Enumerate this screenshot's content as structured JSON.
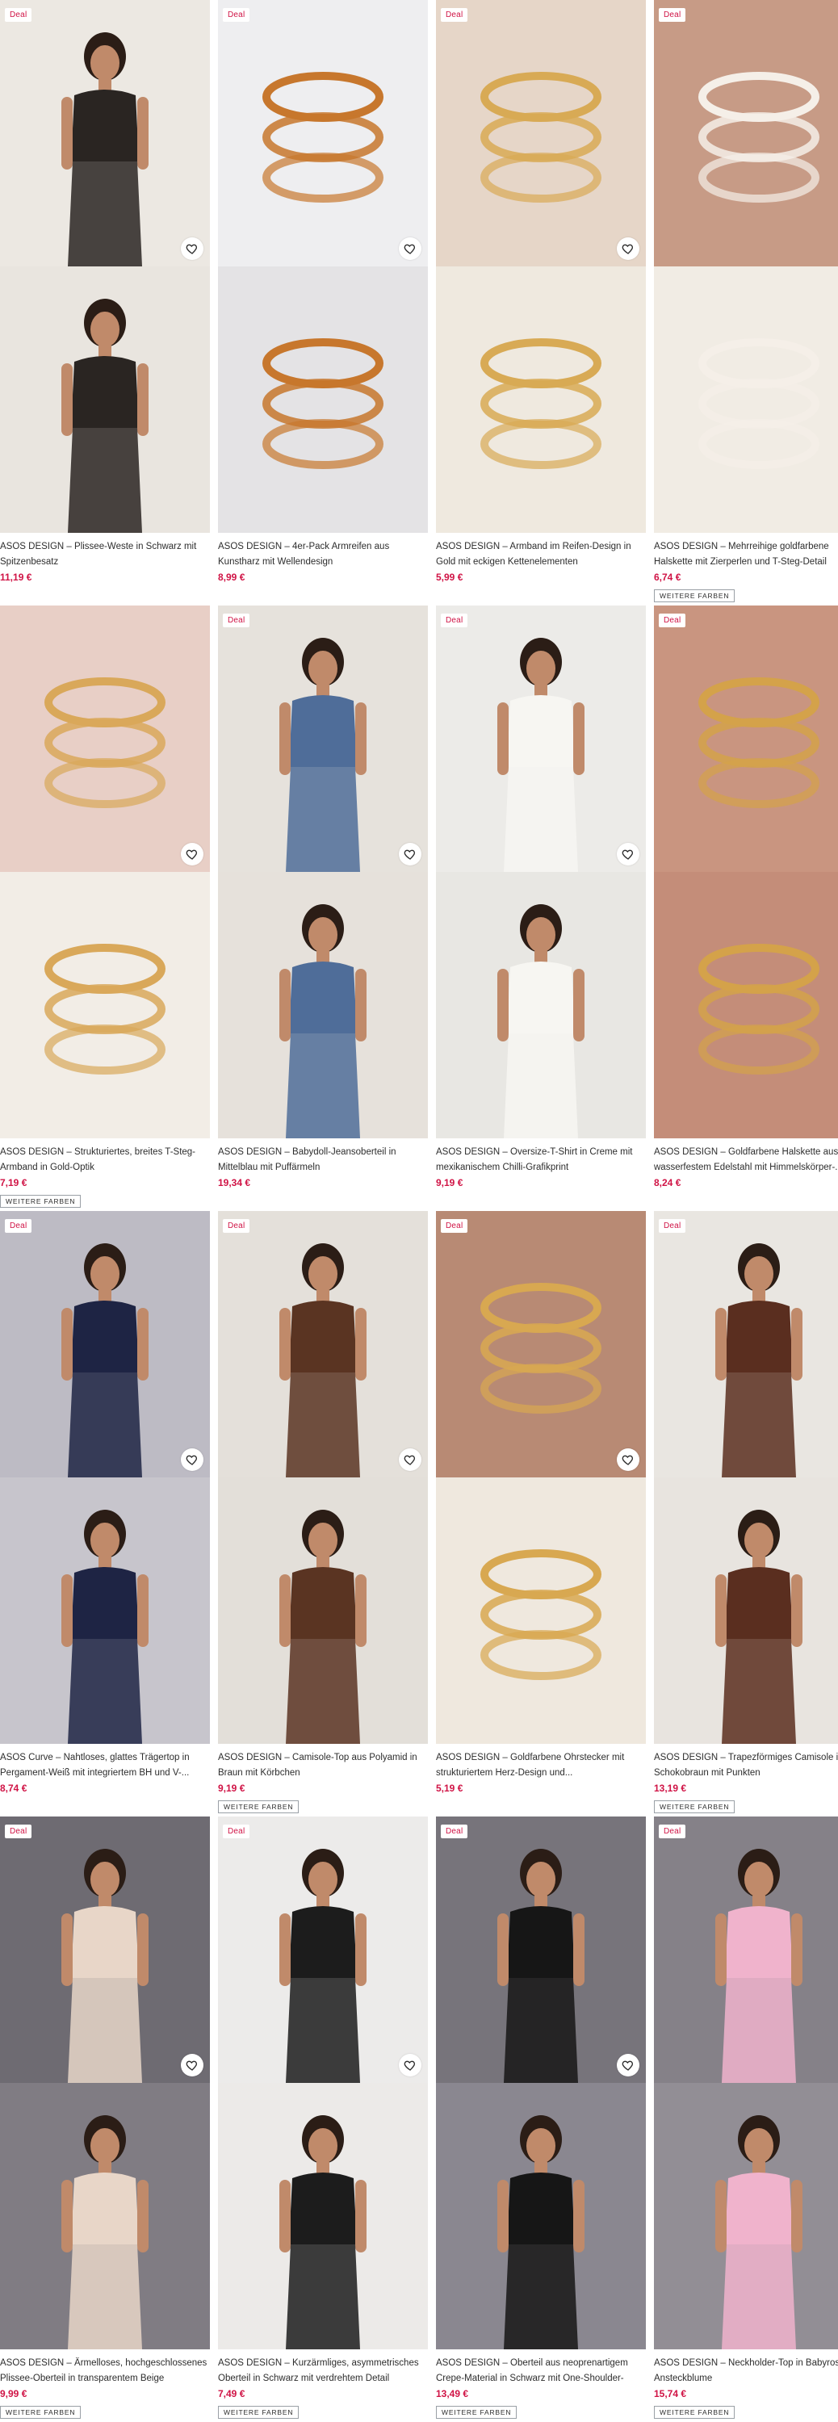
{
  "colors": {
    "deal": "#d01345",
    "price": "#d01345",
    "text": "#2d2d2d"
  },
  "products": [
    {
      "title": "ASOS DESIGN – Plissee-Weste in Schwarz mit Spitzenbesatz",
      "price": "11,19 €",
      "deal": "Deal",
      "more": "",
      "heart": true,
      "bg": "#ece8e2",
      "alt_bg": "#e9e5df",
      "subject": "woman-black-vest",
      "tone": "#2a2522"
    },
    {
      "title": "ASOS DESIGN – 4er-Pack Armreifen aus Kunstharz mit Wellendesign",
      "price": "8,99 €",
      "deal": "Deal",
      "more": "",
      "heart": true,
      "bg": "#eeeef0",
      "alt_bg": "#e4e3e5",
      "subject": "amber-bangles",
      "tone": "#c7772d"
    },
    {
      "title": "ASOS DESIGN – Armband im Reifen-Design in Gold mit eckigen Kettenelementen",
      "price": "5,99 €",
      "deal": "Deal",
      "more": "",
      "heart": true,
      "bg": "#e6d6c8",
      "alt_bg": "#efe9df",
      "subject": "gold-chain-bracelet",
      "tone": "#d8aa55"
    },
    {
      "title": "ASOS DESIGN – Mehrreihige goldfarbene Halskette mit Zierperlen und T-Steg-Detail",
      "price": "6,74 €",
      "deal": "Deal",
      "more": "WEITERE FARBEN",
      "heart": false,
      "bg": "#c79b86",
      "alt_bg": "#f1ece4",
      "subject": "pearl-necklace",
      "tone": "#f5efe8"
    },
    {
      "title": "ASOS DESIGN – Strukturiertes, breites T-Steg-Armband in Gold-Optik",
      "price": "7,19 €",
      "deal": "",
      "more": "WEITERE FARBEN",
      "heart": true,
      "bg": "#e8cfc6",
      "alt_bg": "#f2ede6",
      "subject": "gold-link-bracelet",
      "tone": "#d9a85a"
    },
    {
      "title": "ASOS DESIGN – Babydoll-Jeansoberteil in Mittelblau mit Puffärmeln",
      "price": "19,34 €",
      "deal": "Deal",
      "more": "",
      "heart": true,
      "bg": "#e6e2dc",
      "alt_bg": "#e6e1db",
      "subject": "woman-denim-set",
      "tone": "#4f6d99"
    },
    {
      "title": "ASOS DESIGN – Oversize-T-Shirt in Creme mit mexikanischem Chilli-Grafikprint",
      "price": "9,19 €",
      "deal": "Deal",
      "more": "",
      "heart": true,
      "bg": "#ecebe8",
      "alt_bg": "#e8e7e3",
      "subject": "woman-white-tee",
      "tone": "#f7f6f2"
    },
    {
      "title": "ASOS DESIGN – Goldfarbene Halskette aus wasserfestem Edelstahl mit Himmelskörper-...",
      "price": "8,24 €",
      "deal": "Deal",
      "more": "",
      "heart": false,
      "bg": "#c99580",
      "alt_bg": "#c48d79",
      "subject": "gold-pendant",
      "tone": "#d4a24a"
    },
    {
      "title": "ASOS Curve – Nahtloses, glattes Trägertop in Pergament-Weiß mit integriertem BH und V-...",
      "price": "8,74 €",
      "deal": "Deal",
      "more": "",
      "heart": true,
      "bg": "#bdbbc4",
      "alt_bg": "#c7c5cc",
      "subject": "woman-tank-leggings",
      "tone": "#1e2444"
    },
    {
      "title": "ASOS DESIGN – Camisole-Top aus Polyamid in Braun mit Körbchen",
      "price": "9,19 €",
      "deal": "Deal",
      "more": "WEITERE FARBEN",
      "heart": true,
      "bg": "#e4e0da",
      "alt_bg": "#e3dfd9",
      "subject": "woman-brown-cami",
      "tone": "#5a3422"
    },
    {
      "title": "ASOS DESIGN – Goldfarbene Ohrstecker mit strukturiertem Herz-Design und...",
      "price": "5,19 €",
      "deal": "Deal",
      "more": "",
      "heart": true,
      "bg": "#b88a74",
      "alt_bg": "#efe8de",
      "subject": "heart-pearl-earrings",
      "tone": "#d8a851"
    },
    {
      "title": "ASOS DESIGN – Trapezförmiges Camisole in Schokobraun mit Punkten",
      "price": "13,19 €",
      "deal": "Deal",
      "more": "WEITERE FARBEN",
      "heart": false,
      "bg": "#e9e6e1",
      "alt_bg": "#e8e4df",
      "subject": "woman-polka-set",
      "tone": "#5a2e1f"
    },
    {
      "title": "ASOS DESIGN – Ärmelloses, hochgeschlossenes Plissee-Oberteil in transparentem Beige",
      "price": "9,99 €",
      "deal": "Deal",
      "more": "WEITERE FARBEN",
      "heart": true,
      "bg": "#6e6b72",
      "alt_bg": "#807c83",
      "subject": "woman-sheer-top",
      "tone": "#e8d6c8"
    },
    {
      "title": "ASOS DESIGN – Kurzärmliges, asymmetrisches Oberteil in Schwarz mit verdrehtem Detail",
      "price": "7,49 €",
      "deal": "Deal",
      "more": "WEITERE FARBEN",
      "heart": true,
      "bg": "#ecebea",
      "alt_bg": "#eceae8",
      "subject": "woman-black-twist-top",
      "tone": "#1c1c1c"
    },
    {
      "title": "ASOS DESIGN – Oberteil aus neoprenartigem Crepe-Material in Schwarz mit One-Shoulder-Träg...",
      "price": "13,49 €",
      "deal": "Deal",
      "more": "WEITERE FARBEN",
      "heart": true,
      "bg": "#77747b",
      "alt_bg": "#8a8790",
      "subject": "woman-one-shoulder",
      "tone": "#161616"
    },
    {
      "title": "ASOS DESIGN – Neckholder-Top in Babyrosa mit Ansteckblume",
      "price": "15,74 €",
      "deal": "Deal",
      "more": "WEITERE FARBEN",
      "heart": false,
      "bg": "#858188",
      "alt_bg": "#928e95",
      "subject": "woman-pink-flower-top",
      "tone": "#f0b3cc"
    }
  ]
}
